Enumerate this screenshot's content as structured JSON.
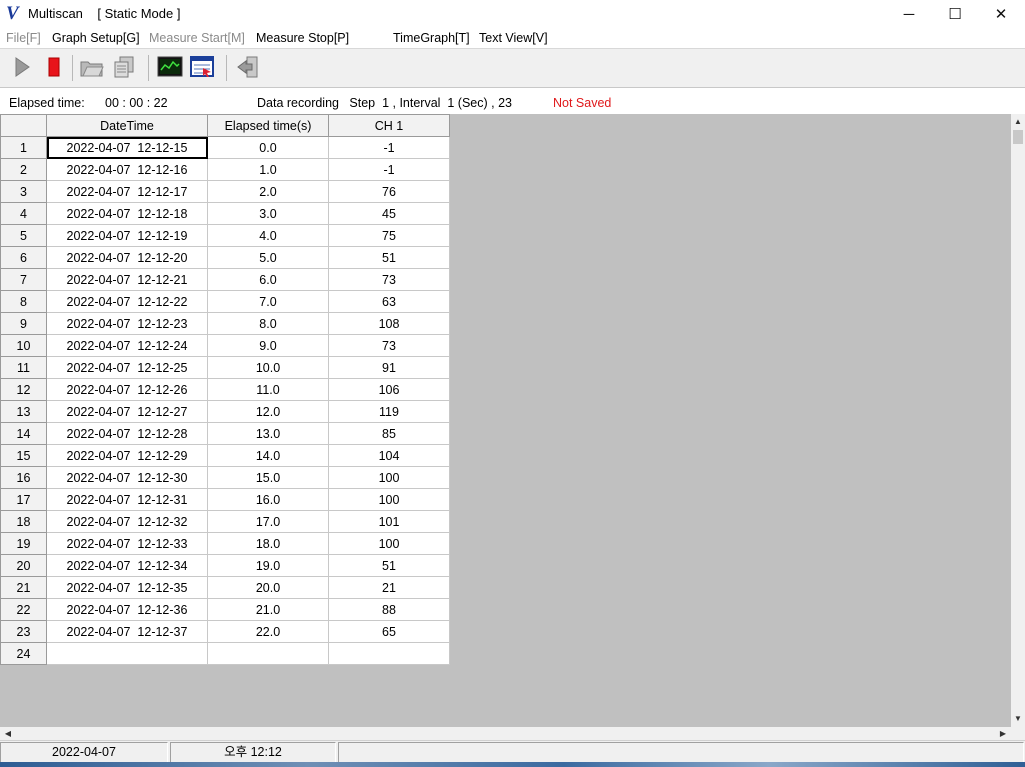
{
  "window": {
    "logo": "V",
    "title": "Multiscan",
    "mode": "[ Static Mode ]",
    "controls": {
      "minimize": "─",
      "maximize": "☐",
      "close": "✕"
    }
  },
  "menu": [
    {
      "label": "File[F]",
      "enabled": false
    },
    {
      "label": "Graph Setup[G]",
      "enabled": true
    },
    {
      "label": "Measure Start[M]",
      "enabled": false
    },
    {
      "label": "Measure Stop[P]",
      "enabled": true
    },
    {
      "label": "TimeGraph[T]",
      "enabled": true
    },
    {
      "label": "Text View[V]",
      "enabled": true
    }
  ],
  "toolbar": {
    "buttons": [
      "play-icon",
      "stop-icon",
      "open-folder-icon",
      "copy-data-icon",
      "time-graph-icon",
      "text-view-icon",
      "exit-icon"
    ]
  },
  "info": {
    "elapsed_label": "Elapsed time:",
    "elapsed_value": "00 : 00 : 22",
    "recording": "Data recording   Step  1 , Interval  1 (Sec) , 23",
    "save_status": "Not Saved",
    "save_status_color": "#e0191b"
  },
  "grid": {
    "columns": [
      "",
      "DateTime",
      "Elapsed time(s)",
      "CH 1"
    ],
    "rows": [
      [
        "1",
        "2022-04-07  12-12-15",
        "0.0",
        "-1"
      ],
      [
        "2",
        "2022-04-07  12-12-16",
        "1.0",
        "-1"
      ],
      [
        "3",
        "2022-04-07  12-12-17",
        "2.0",
        "76"
      ],
      [
        "4",
        "2022-04-07  12-12-18",
        "3.0",
        "45"
      ],
      [
        "5",
        "2022-04-07  12-12-19",
        "4.0",
        "75"
      ],
      [
        "6",
        "2022-04-07  12-12-20",
        "5.0",
        "51"
      ],
      [
        "7",
        "2022-04-07  12-12-21",
        "6.0",
        "73"
      ],
      [
        "8",
        "2022-04-07  12-12-22",
        "7.0",
        "63"
      ],
      [
        "9",
        "2022-04-07  12-12-23",
        "8.0",
        "108"
      ],
      [
        "10",
        "2022-04-07  12-12-24",
        "9.0",
        "73"
      ],
      [
        "11",
        "2022-04-07  12-12-25",
        "10.0",
        "91"
      ],
      [
        "12",
        "2022-04-07  12-12-26",
        "11.0",
        "106"
      ],
      [
        "13",
        "2022-04-07  12-12-27",
        "12.0",
        "119"
      ],
      [
        "14",
        "2022-04-07  12-12-28",
        "13.0",
        "85"
      ],
      [
        "15",
        "2022-04-07  12-12-29",
        "14.0",
        "104"
      ],
      [
        "16",
        "2022-04-07  12-12-30",
        "15.0",
        "100"
      ],
      [
        "17",
        "2022-04-07  12-12-31",
        "16.0",
        "100"
      ],
      [
        "18",
        "2022-04-07  12-12-32",
        "17.0",
        "101"
      ],
      [
        "19",
        "2022-04-07  12-12-33",
        "18.0",
        "100"
      ],
      [
        "20",
        "2022-04-07  12-12-34",
        "19.0",
        "51"
      ],
      [
        "21",
        "2022-04-07  12-12-35",
        "20.0",
        "21"
      ],
      [
        "22",
        "2022-04-07  12-12-36",
        "21.0",
        "88"
      ],
      [
        "23",
        "2022-04-07  12-12-37",
        "22.0",
        "65"
      ],
      [
        "24",
        "",
        "",
        ""
      ]
    ]
  },
  "statusbar": {
    "date": "2022-04-07",
    "time": "오후 12:12",
    "extra": ""
  }
}
